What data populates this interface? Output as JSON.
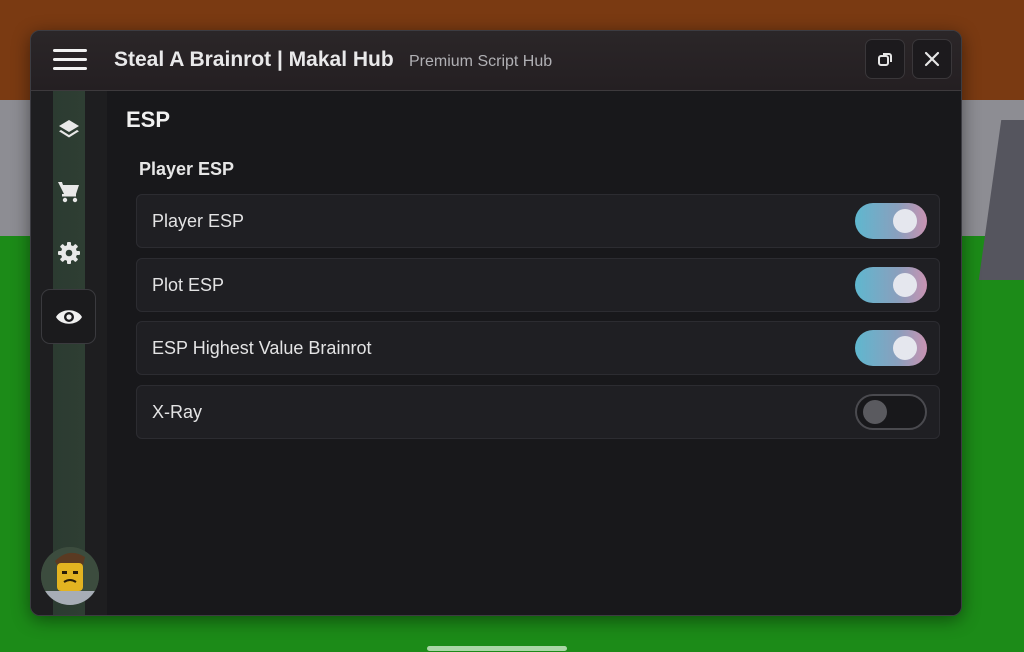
{
  "window": {
    "title": "Steal A Brainrot | Makal Hub",
    "subtitle": "Premium Script Hub"
  },
  "titlebar_buttons": [
    {
      "icon": "restore-icon"
    },
    {
      "icon": "close-icon"
    }
  ],
  "sidebar": {
    "items": [
      {
        "icon": "layers-icon",
        "active": false
      },
      {
        "icon": "cart-icon",
        "active": false
      },
      {
        "icon": "gear-icon",
        "active": false
      },
      {
        "icon": "eye-icon",
        "active": true
      }
    ],
    "avatar": "avatar"
  },
  "page": {
    "title": "ESP",
    "section": "Player ESP",
    "toggles": [
      {
        "label": "Player ESP",
        "on": true
      },
      {
        "label": "Plot ESP",
        "on": true
      },
      {
        "label": "ESP Highest Value Brainrot",
        "on": true
      },
      {
        "label": "X-Ray",
        "on": false
      }
    ]
  },
  "colors": {
    "toggle_on_gradient": [
      "#5fb7cf",
      "#c993b2"
    ],
    "panel_bg": "#18181b",
    "titlebar_bg": "#2b2628"
  }
}
